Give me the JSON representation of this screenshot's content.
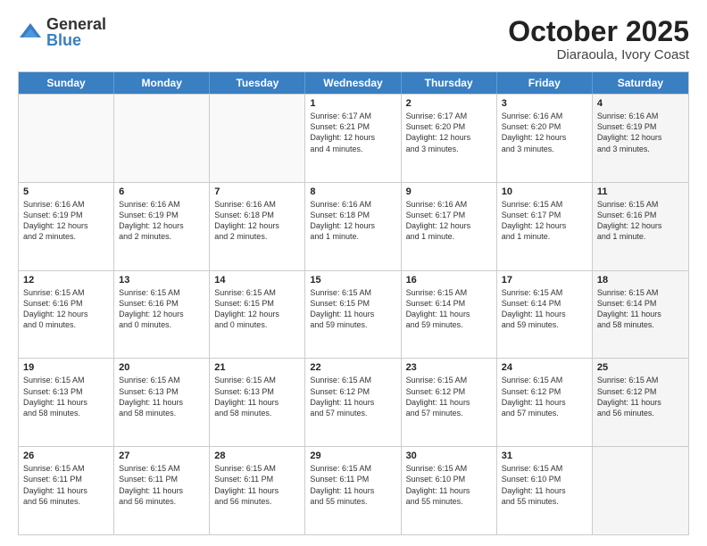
{
  "logo": {
    "general": "General",
    "blue": "Blue"
  },
  "title": {
    "month": "October 2025",
    "location": "Diaraoula, Ivory Coast"
  },
  "calendar": {
    "headers": [
      "Sunday",
      "Monday",
      "Tuesday",
      "Wednesday",
      "Thursday",
      "Friday",
      "Saturday"
    ],
    "rows": [
      [
        {
          "day": "",
          "info": "",
          "empty": true
        },
        {
          "day": "",
          "info": "",
          "empty": true
        },
        {
          "day": "",
          "info": "",
          "empty": true
        },
        {
          "day": "1",
          "info": "Sunrise: 6:17 AM\nSunset: 6:21 PM\nDaylight: 12 hours\nand 4 minutes."
        },
        {
          "day": "2",
          "info": "Sunrise: 6:17 AM\nSunset: 6:20 PM\nDaylight: 12 hours\nand 3 minutes."
        },
        {
          "day": "3",
          "info": "Sunrise: 6:16 AM\nSunset: 6:20 PM\nDaylight: 12 hours\nand 3 minutes."
        },
        {
          "day": "4",
          "info": "Sunrise: 6:16 AM\nSunset: 6:19 PM\nDaylight: 12 hours\nand 3 minutes.",
          "shaded": true
        }
      ],
      [
        {
          "day": "5",
          "info": "Sunrise: 6:16 AM\nSunset: 6:19 PM\nDaylight: 12 hours\nand 2 minutes."
        },
        {
          "day": "6",
          "info": "Sunrise: 6:16 AM\nSunset: 6:19 PM\nDaylight: 12 hours\nand 2 minutes."
        },
        {
          "day": "7",
          "info": "Sunrise: 6:16 AM\nSunset: 6:18 PM\nDaylight: 12 hours\nand 2 minutes."
        },
        {
          "day": "8",
          "info": "Sunrise: 6:16 AM\nSunset: 6:18 PM\nDaylight: 12 hours\nand 1 minute."
        },
        {
          "day": "9",
          "info": "Sunrise: 6:16 AM\nSunset: 6:17 PM\nDaylight: 12 hours\nand 1 minute."
        },
        {
          "day": "10",
          "info": "Sunrise: 6:15 AM\nSunset: 6:17 PM\nDaylight: 12 hours\nand 1 minute."
        },
        {
          "day": "11",
          "info": "Sunrise: 6:15 AM\nSunset: 6:16 PM\nDaylight: 12 hours\nand 1 minute.",
          "shaded": true
        }
      ],
      [
        {
          "day": "12",
          "info": "Sunrise: 6:15 AM\nSunset: 6:16 PM\nDaylight: 12 hours\nand 0 minutes."
        },
        {
          "day": "13",
          "info": "Sunrise: 6:15 AM\nSunset: 6:16 PM\nDaylight: 12 hours\nand 0 minutes."
        },
        {
          "day": "14",
          "info": "Sunrise: 6:15 AM\nSunset: 6:15 PM\nDaylight: 12 hours\nand 0 minutes."
        },
        {
          "day": "15",
          "info": "Sunrise: 6:15 AM\nSunset: 6:15 PM\nDaylight: 11 hours\nand 59 minutes."
        },
        {
          "day": "16",
          "info": "Sunrise: 6:15 AM\nSunset: 6:14 PM\nDaylight: 11 hours\nand 59 minutes."
        },
        {
          "day": "17",
          "info": "Sunrise: 6:15 AM\nSunset: 6:14 PM\nDaylight: 11 hours\nand 59 minutes."
        },
        {
          "day": "18",
          "info": "Sunrise: 6:15 AM\nSunset: 6:14 PM\nDaylight: 11 hours\nand 58 minutes.",
          "shaded": true
        }
      ],
      [
        {
          "day": "19",
          "info": "Sunrise: 6:15 AM\nSunset: 6:13 PM\nDaylight: 11 hours\nand 58 minutes."
        },
        {
          "day": "20",
          "info": "Sunrise: 6:15 AM\nSunset: 6:13 PM\nDaylight: 11 hours\nand 58 minutes."
        },
        {
          "day": "21",
          "info": "Sunrise: 6:15 AM\nSunset: 6:13 PM\nDaylight: 11 hours\nand 58 minutes."
        },
        {
          "day": "22",
          "info": "Sunrise: 6:15 AM\nSunset: 6:12 PM\nDaylight: 11 hours\nand 57 minutes."
        },
        {
          "day": "23",
          "info": "Sunrise: 6:15 AM\nSunset: 6:12 PM\nDaylight: 11 hours\nand 57 minutes."
        },
        {
          "day": "24",
          "info": "Sunrise: 6:15 AM\nSunset: 6:12 PM\nDaylight: 11 hours\nand 57 minutes."
        },
        {
          "day": "25",
          "info": "Sunrise: 6:15 AM\nSunset: 6:12 PM\nDaylight: 11 hours\nand 56 minutes.",
          "shaded": true
        }
      ],
      [
        {
          "day": "26",
          "info": "Sunrise: 6:15 AM\nSunset: 6:11 PM\nDaylight: 11 hours\nand 56 minutes."
        },
        {
          "day": "27",
          "info": "Sunrise: 6:15 AM\nSunset: 6:11 PM\nDaylight: 11 hours\nand 56 minutes."
        },
        {
          "day": "28",
          "info": "Sunrise: 6:15 AM\nSunset: 6:11 PM\nDaylight: 11 hours\nand 56 minutes."
        },
        {
          "day": "29",
          "info": "Sunrise: 6:15 AM\nSunset: 6:11 PM\nDaylight: 11 hours\nand 55 minutes."
        },
        {
          "day": "30",
          "info": "Sunrise: 6:15 AM\nSunset: 6:10 PM\nDaylight: 11 hours\nand 55 minutes."
        },
        {
          "day": "31",
          "info": "Sunrise: 6:15 AM\nSunset: 6:10 PM\nDaylight: 11 hours\nand 55 minutes."
        },
        {
          "day": "",
          "info": "",
          "empty": true,
          "shaded": true
        }
      ]
    ]
  }
}
